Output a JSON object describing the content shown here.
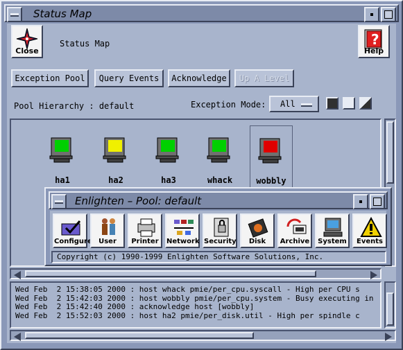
{
  "window": {
    "title": "Status Map",
    "header_label": "Status Map",
    "close_label": "Close",
    "help_label": "Help"
  },
  "toolbar": {
    "exception_pool": "Exception Pool",
    "query_events": "Query Events",
    "acknowledge": "Acknowledge",
    "up_a_level": "Up A Level"
  },
  "pool": {
    "hierarchy_label": "Pool Hierarchy : default",
    "exception_mode_label": "Exception Mode:",
    "exception_mode_value": "All"
  },
  "hosts": [
    {
      "name": "ha1",
      "status_color": "#00d000"
    },
    {
      "name": "ha2",
      "status_color": "#f0f000"
    },
    {
      "name": "ha3",
      "status_color": "#00d000"
    },
    {
      "name": "whack",
      "status_color": "#00d000"
    },
    {
      "name": "wobbly",
      "status_color": "#e00000"
    }
  ],
  "subwindow": {
    "title": "Enlighten – Pool: default",
    "tools": [
      "Configure",
      "User",
      "Printer",
      "Network",
      "Security",
      "Disk",
      "Archive",
      "System",
      "Events"
    ],
    "copyright": "Copyright (c) 1990-1999 Enlighten Software Solutions, Inc."
  },
  "log": [
    "Wed Feb  2 15:38:05 2000 : host whack pmie/per_cpu.syscall - High per CPU s",
    "Wed Feb  2 15:42:03 2000 : host wobbly pmie/per_cpu.system - Busy executing in",
    "Wed Feb  2 15:42:40 2000 : acknowledge host [wobbly]",
    "Wed Feb  2 15:52:03 2000 : host ha2 pmie/per_disk.util - High per spindle c"
  ]
}
